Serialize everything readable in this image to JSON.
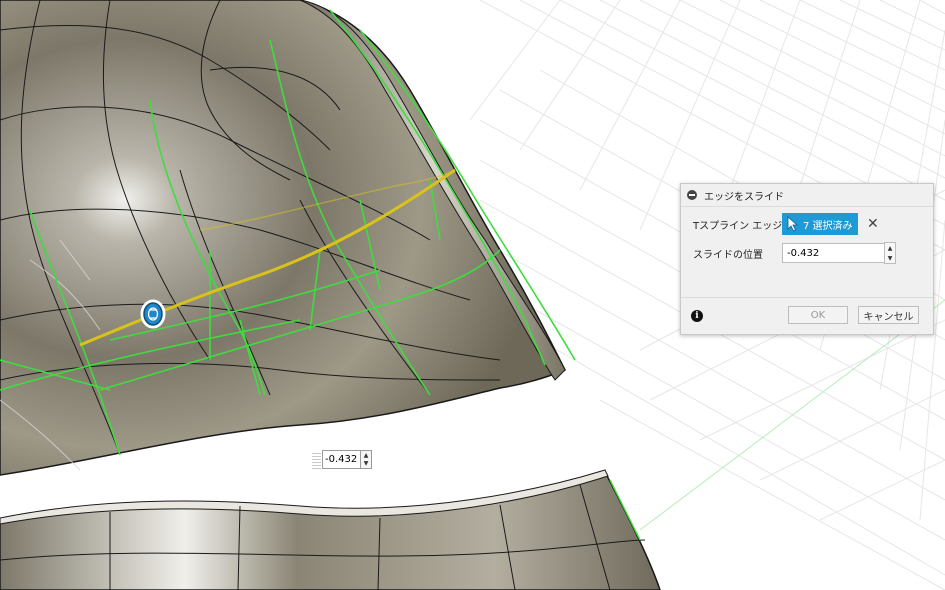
{
  "viewport": {
    "background": "#ffffff",
    "surface_color": "#8f8a7a",
    "edge_color": "#1a1a1a",
    "selected_edge_color": "#3fdc3f",
    "slide_edge_color": "#d9c31a",
    "manipulator_icon": "slide-manipulator-icon"
  },
  "dialog": {
    "title": "エッジをスライド",
    "rows": [
      {
        "label": "Tスプライン エッジ",
        "button": "7 選択済み"
      },
      {
        "label": "スライドの位置",
        "value": "-0.432"
      }
    ],
    "ok_label": "OK",
    "cancel_label": "キャンセル"
  },
  "float_input": {
    "value": "-0.432"
  }
}
